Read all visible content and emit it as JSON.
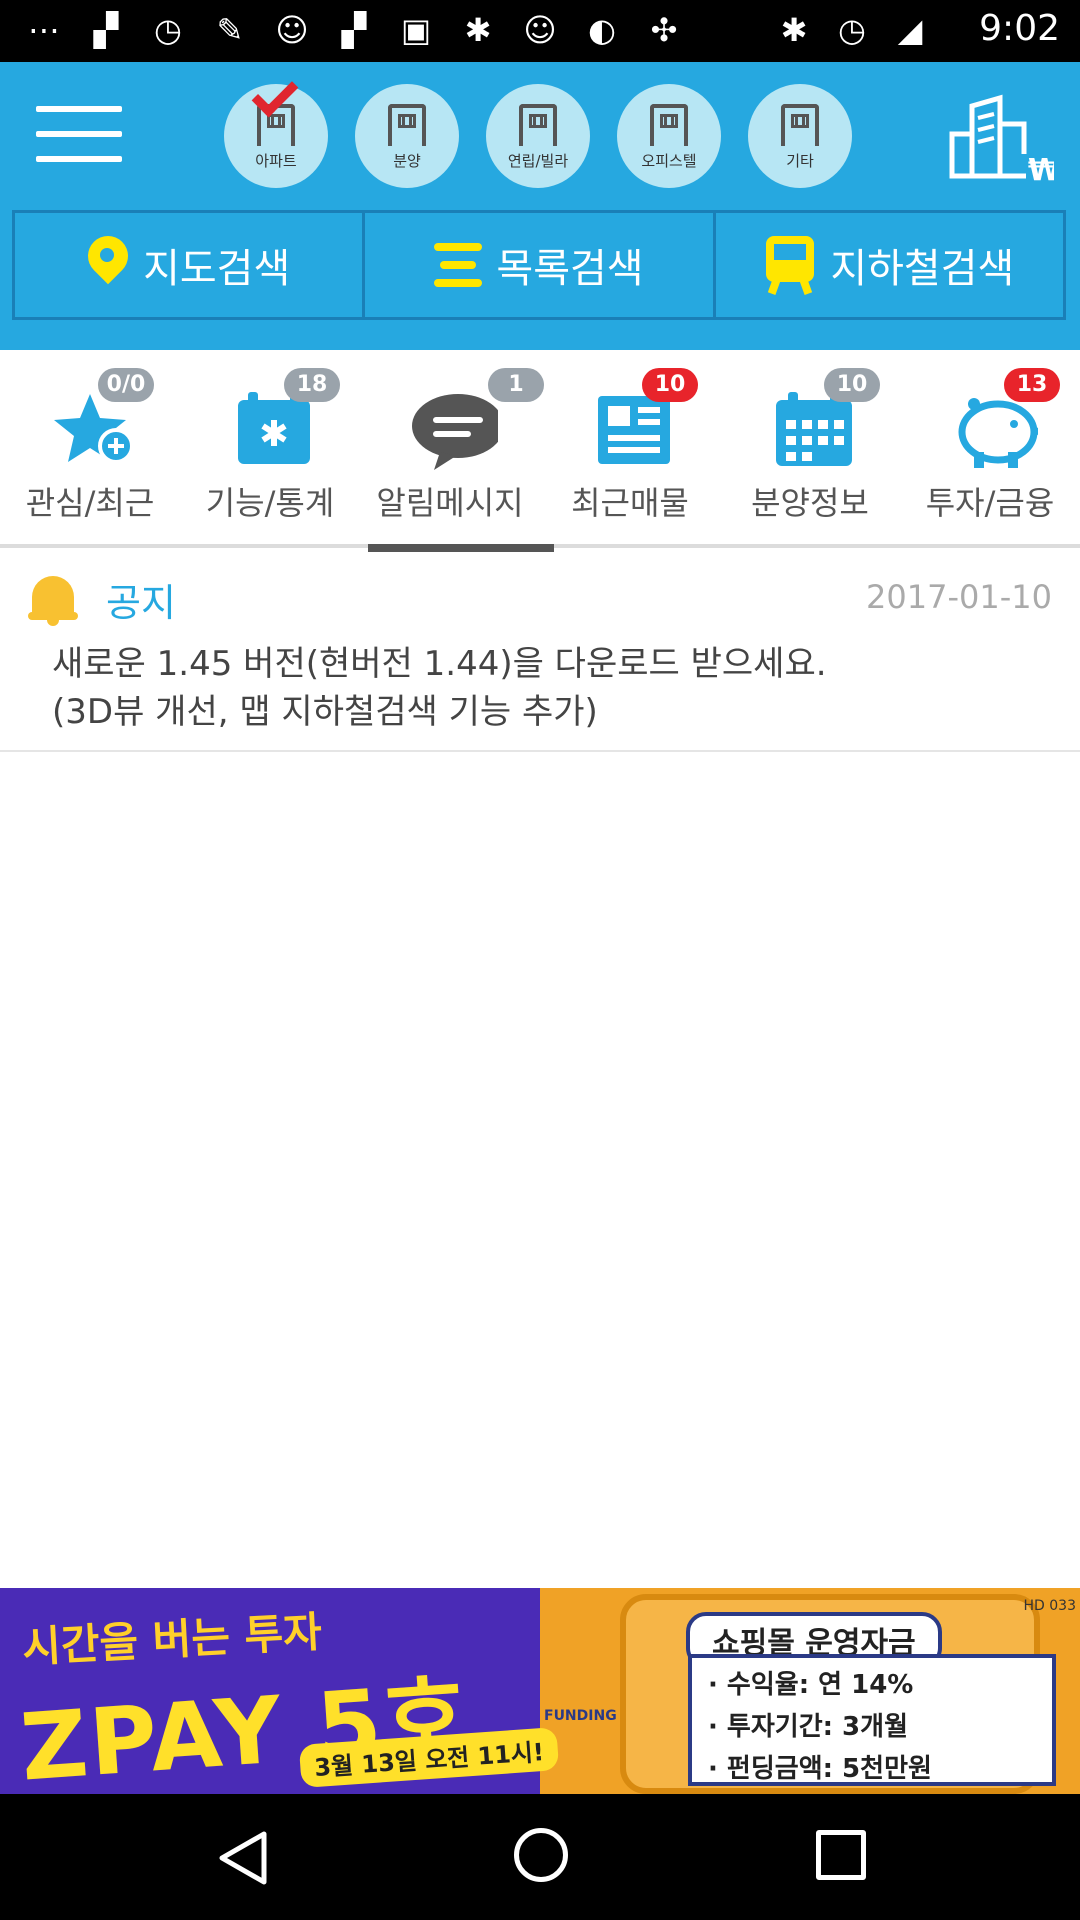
{
  "status_bar": {
    "time": "9:02"
  },
  "header": {
    "categories": [
      {
        "label": "아파트",
        "selected": true
      },
      {
        "label": "분양",
        "selected": false
      },
      {
        "label": "연립/빌라",
        "selected": false
      },
      {
        "label": "오피스텔",
        "selected": false
      },
      {
        "label": "기타",
        "selected": false
      }
    ],
    "search_tabs": [
      {
        "label": "지도검색",
        "icon": "map-pin-icon"
      },
      {
        "label": "목록검색",
        "icon": "list-icon"
      },
      {
        "label": "지하철검색",
        "icon": "subway-icon"
      }
    ],
    "colors": {
      "primary": "#26a8e0",
      "accent": "#ffe600",
      "border": "#1a7fb7"
    }
  },
  "feature_tabs": [
    {
      "label": "관심/최근",
      "badge": "0/0",
      "badge_color": "gray",
      "icon": "star-plus-icon",
      "active": false
    },
    {
      "label": "기능/통계",
      "badge": "18",
      "badge_color": "gray",
      "icon": "calendar-star-icon",
      "active": false
    },
    {
      "label": "알림메시지",
      "badge": "1",
      "badge_color": "gray",
      "icon": "chat-bubble-icon",
      "active": true
    },
    {
      "label": "최근매물",
      "badge": "10",
      "badge_color": "red",
      "icon": "newspaper-icon",
      "active": false
    },
    {
      "label": "분양정보",
      "badge": "10",
      "badge_color": "gray",
      "icon": "calendar-icon",
      "active": false
    },
    {
      "label": "투자/금융",
      "badge": "13",
      "badge_color": "red",
      "icon": "piggy-bank-icon",
      "active": false
    }
  ],
  "notice": {
    "title": "공지",
    "date": "2017-01-10",
    "body_line1": "새로운 1.45 버전(현버전 1.44)을 다운로드 받으세요.",
    "body_line2": "(3D뷰 개선, 맵 지하철검색 기능 추가)"
  },
  "ad_banner": {
    "headline": "시간을 버는 투자",
    "product": "ZPAY 5호",
    "date": "3월 13일 오전 11시!",
    "brand": "FUNDING FACTORY",
    "tag": "쇼핑몰 운영자금",
    "line1": "· 수익율: 연 14%",
    "line2": "· 투자기간: 3개월",
    "line3": "· 펀딩금액: 5천만원",
    "code": "HD 033"
  }
}
